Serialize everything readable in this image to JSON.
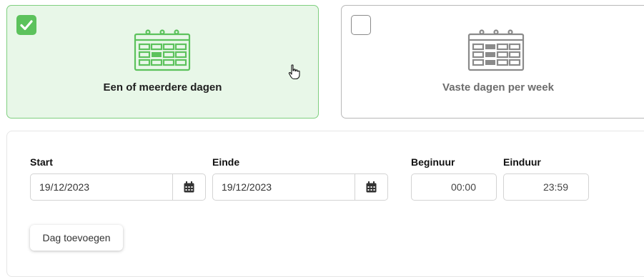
{
  "options": [
    {
      "label": "Een of meerdere dagen",
      "selected": true,
      "icon": "calendar-icon"
    },
    {
      "label": "Vaste dagen per week",
      "selected": false,
      "icon": "calendar-week-icon"
    }
  ],
  "form": {
    "start_label": "Start",
    "start_value": "19/12/2023",
    "end_label": "Einde",
    "end_value": "19/12/2023",
    "begin_hour_label": "Beginuur",
    "begin_hour_value": "00:00",
    "end_hour_label": "Einduur",
    "end_hour_value": "23:59"
  },
  "add_day_button": "Dag toevoegen",
  "colors": {
    "selected_accent": "#5cc25c",
    "selected_bg": "#e8f7e8",
    "unselected_icon": "#8a8a8a"
  }
}
